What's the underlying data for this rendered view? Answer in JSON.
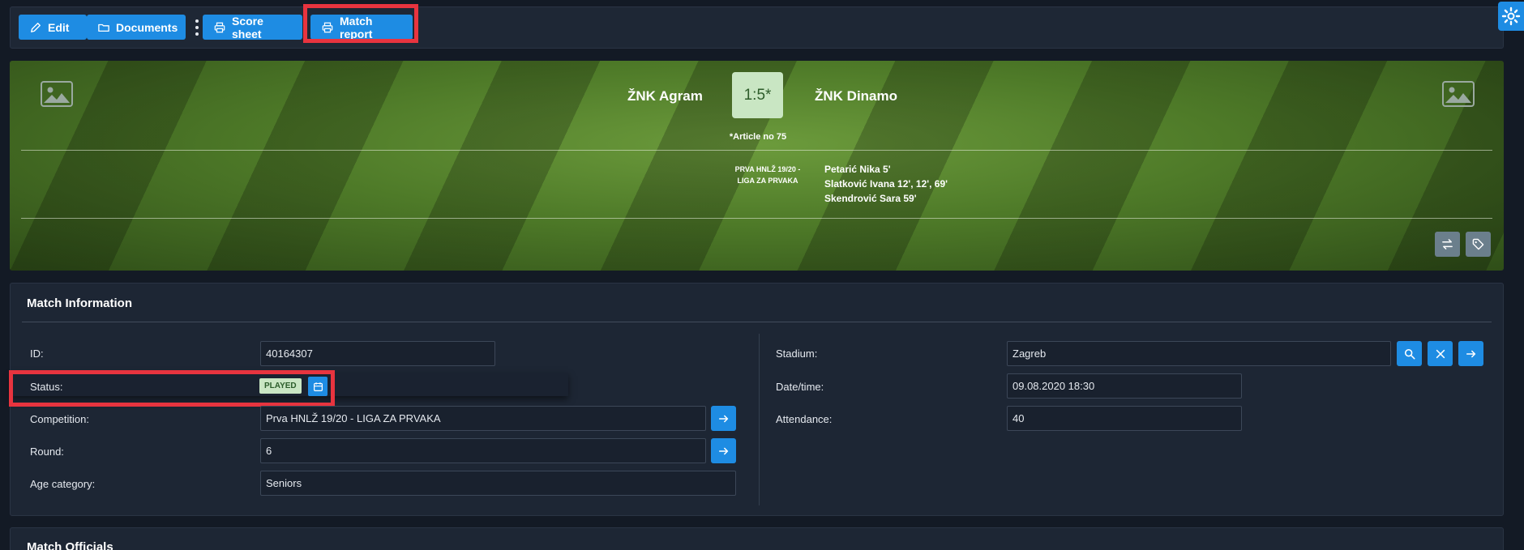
{
  "toolbar": {
    "edit_label": "Edit",
    "documents_label": "Documents",
    "score_sheet_label": "Score sheet",
    "match_report_label": "Match report"
  },
  "match": {
    "home_team": "ŽNK Agram",
    "away_team": "ŽNK Dinamo",
    "score": "1:5*",
    "note": "*Article no 75",
    "competition_line1": "PRVA HNLŽ 19/20 -",
    "competition_line2": "LIGA ZA PRVAKA",
    "scorers": [
      "Petarić Nika 5'",
      "Slatković Ivana 12', 12', 69'",
      "Skendrović Sara 59'"
    ]
  },
  "info": {
    "title": "Match Information",
    "id_label": "ID:",
    "id_value": "40164307",
    "status_label": "Status:",
    "status_value": "PLAYED",
    "competition_label": "Competition:",
    "competition_value": "Prva HNLŽ 19/20 - LIGA ZA PRVAKA",
    "round_label": "Round:",
    "round_value": "6",
    "age_label": "Age category:",
    "age_value": "Seniors",
    "stadium_label": "Stadium:",
    "stadium_value": "Zagreb",
    "datetime_label": "Date/time:",
    "datetime_value": "09.08.2020 18:30",
    "attendance_label": "Attendance:",
    "attendance_value": "40"
  },
  "officials": {
    "title": "Match Officials"
  },
  "colors": {
    "accent": "#1e8ce3",
    "highlight": "#e8343f",
    "status_badge": "#c9e6c3"
  }
}
